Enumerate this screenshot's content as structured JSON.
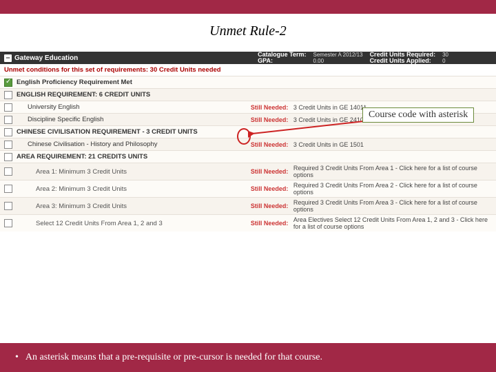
{
  "title": "Unmet Rule-2",
  "header": {
    "section": "Gateway Education",
    "catalogue_label": "Catalogue Term:",
    "catalogue_value": "Semester A 2012/13",
    "gpa_label": "GPA:",
    "gpa_value": "0.00",
    "req_label": "Credit Units Required:",
    "req_value": "30",
    "app_label": "Credit Units Applied:",
    "app_value": "0"
  },
  "unmet_line": "Unmet conditions for this set of requirements:   30 Credit Units needed",
  "rows": [
    {
      "chk": "on",
      "cls": "",
      "name": "English Proficiency Requirement Met",
      "need": "",
      "detail": ""
    },
    {
      "chk": "off",
      "cls": "",
      "name": "ENGLISH REQUIREMENT: 6 CREDIT UNITS",
      "need": "",
      "detail": ""
    },
    {
      "chk": "off",
      "cls": "indent",
      "name": "University English",
      "need": "Still Needed:",
      "detail": "3 Credit Units in GE 1401*"
    },
    {
      "chk": "off",
      "cls": "indent",
      "name": "Discipline Specific English",
      "need": "Still Needed:",
      "detail": "3 Credit Units in GE 2410 or 2411"
    },
    {
      "chk": "off",
      "cls": "",
      "name": "CHINESE CIVILISATION REQUIREMENT - 3 CREDIT UNITS",
      "need": "",
      "detail": ""
    },
    {
      "chk": "off",
      "cls": "indent",
      "name": "Chinese Civilisation - History and Philosophy",
      "need": "Still Needed:",
      "detail": "3 Credit Units in GE 1501"
    },
    {
      "chk": "off",
      "cls": "",
      "name": "AREA REQUIREMENT: 21 CREDITS UNITS",
      "need": "",
      "detail": ""
    },
    {
      "chk": "off",
      "cls": "sub",
      "name": "Area 1: Minimum 3 Credit Units",
      "need": "Still Needed:",
      "detail": "Required 3 Credit Units From Area 1 - Click here for a list of course options"
    },
    {
      "chk": "off",
      "cls": "sub",
      "name": "Area 2: Minimum 3 Credit Units",
      "need": "Still Needed:",
      "detail": "Required 3 Credit Units From Area 2 - Click here for a list of course options"
    },
    {
      "chk": "off",
      "cls": "sub",
      "name": "Area 3: Minimum 3 Credit Units",
      "need": "Still Needed:",
      "detail": "Required 3 Credit Units From Area 3 - Click here for a list of course options"
    },
    {
      "chk": "off",
      "cls": "sub",
      "name": "Select 12 Credit Units From Area 1, 2 and 3",
      "need": "Still Needed:",
      "detail": "Area Electives Select 12 Credit Units From Area 1, 2 and 3 - Click here for a list of course options"
    }
  ],
  "callout": "Course code with asterisk",
  "footer": "An asterisk means that a pre-requisite or pre-cursor is needed for that course."
}
